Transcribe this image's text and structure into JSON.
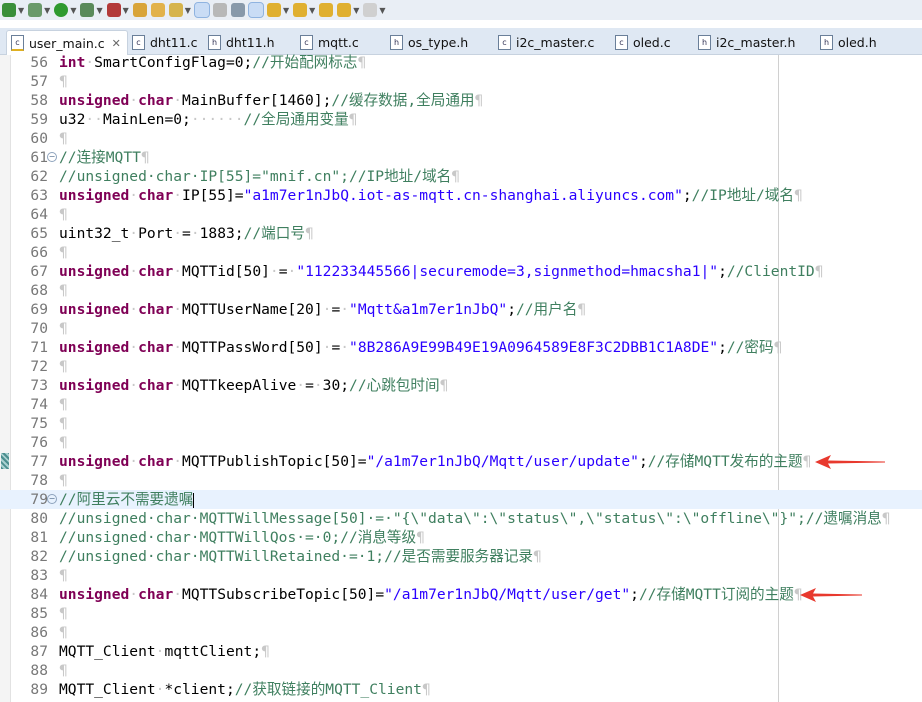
{
  "toolbar": {
    "buttons": [
      {
        "icon": "new-c-project-icon",
        "color": "#3a8f3a",
        "dropdown": true
      },
      {
        "icon": "build-gear-icon",
        "color": "#6a9a6a",
        "dropdown": true
      },
      {
        "icon": "run-icon",
        "color": "#2f9a2f",
        "dropdown": true
      },
      {
        "icon": "debug-icon",
        "color": "#5a8a5a",
        "dropdown": true
      },
      {
        "icon": "external-tools-icon",
        "color": "#b33a3a",
        "dropdown": true
      },
      {
        "icon": "open-type-icon",
        "color": "#d9a53a",
        "dropdown": false
      },
      {
        "icon": "open-folder-icon",
        "color": "#e2b24a",
        "dropdown": false
      },
      {
        "icon": "search-torch-icon",
        "color": "#d6b44c",
        "dropdown": true
      },
      {
        "icon": "mark-occurrences-icon",
        "color": "#e8c95a",
        "dropdown": false,
        "selected": true
      },
      {
        "icon": "word-wrap-icon",
        "color": "#b8b8b8",
        "dropdown": false
      },
      {
        "icon": "block-selection-icon",
        "color": "#8899aa",
        "dropdown": false
      },
      {
        "icon": "show-whitespace-icon",
        "color": "#7f94b0",
        "dropdown": false,
        "selected": true
      },
      {
        "icon": "next-annotation-icon",
        "color": "#e0b030",
        "dropdown": true
      },
      {
        "icon": "previous-annotation-icon",
        "color": "#e0b030",
        "dropdown": true
      },
      {
        "icon": "last-edit-location-icon",
        "color": "#e0b030",
        "dropdown": false
      },
      {
        "icon": "back-icon",
        "color": "#e0b030",
        "dropdown": true
      },
      {
        "icon": "forward-icon",
        "color": "#d0d0d0",
        "dropdown": true
      }
    ]
  },
  "tabs": [
    {
      "label": "user_main.c",
      "type": "c",
      "active": true,
      "warning": true
    },
    {
      "label": "dht11.c",
      "type": "c"
    },
    {
      "label": "dht11.h",
      "type": "h"
    },
    {
      "label": "mqtt.c",
      "type": "c"
    },
    {
      "label": "os_type.h",
      "type": "h"
    },
    {
      "label": "i2c_master.c",
      "type": "c"
    },
    {
      "label": "oled.c",
      "type": "c"
    },
    {
      "label": "i2c_master.h",
      "type": "h"
    },
    {
      "label": "oled.h",
      "type": "h"
    }
  ],
  "tab_close_glyph": "✕",
  "colors": {
    "keyword": "#7f0055",
    "comment": "#3f7f5f",
    "string": "#2a00ff",
    "annotation_arrow": "#e8392e",
    "current_line": "#e8f2fe"
  },
  "editor": {
    "current_line": 79,
    "bookmark_line": 77,
    "arrow_lines": [
      77,
      84
    ],
    "lines": [
      {
        "n": "56",
        "t": [
          [
            "k",
            "int"
          ],
          [
            "w",
            "·"
          ],
          [
            "p",
            "SmartConfigFlag=0;"
          ],
          [
            "c",
            "//开始配网标志"
          ],
          [
            "w",
            "¶"
          ]
        ]
      },
      {
        "n": "57",
        "t": [
          [
            "w",
            "¶"
          ]
        ]
      },
      {
        "n": "58",
        "t": [
          [
            "k",
            "unsigned"
          ],
          [
            "w",
            "·"
          ],
          [
            "k",
            "char"
          ],
          [
            "w",
            "·"
          ],
          [
            "p",
            "MainBuffer[1460];"
          ],
          [
            "c",
            "//缓存数据,全局通用"
          ],
          [
            "w",
            "¶"
          ]
        ]
      },
      {
        "n": "59",
        "t": [
          [
            "p",
            "u32"
          ],
          [
            "w",
            "··"
          ],
          [
            "p",
            "MainLen=0;"
          ],
          [
            "w",
            "······"
          ],
          [
            "c",
            "//全局通用变量"
          ],
          [
            "w",
            "¶"
          ]
        ]
      },
      {
        "n": "60",
        "t": [
          [
            "w",
            "¶"
          ]
        ]
      },
      {
        "n": "61",
        "fold": true,
        "t": [
          [
            "c",
            "//连接MQTT"
          ],
          [
            "w",
            "¶"
          ]
        ]
      },
      {
        "n": "62",
        "t": [
          [
            "c",
            "//unsigned·char·IP[55]=\"mnif.cn\";//IP地址/域名"
          ],
          [
            "w",
            "¶"
          ]
        ]
      },
      {
        "n": "63",
        "t": [
          [
            "k",
            "unsigned"
          ],
          [
            "w",
            "·"
          ],
          [
            "k",
            "char"
          ],
          [
            "w",
            "·"
          ],
          [
            "p",
            "IP[55]="
          ],
          [
            "s",
            "\"a1m7er1nJbQ.iot-as-mqtt.cn-shanghai.aliyuncs.com\""
          ],
          [
            "p",
            ";"
          ],
          [
            "c",
            "//IP地址/域名"
          ],
          [
            "w",
            "¶"
          ]
        ]
      },
      {
        "n": "64",
        "t": [
          [
            "w",
            "¶"
          ]
        ]
      },
      {
        "n": "65",
        "t": [
          [
            "p",
            "uint32_t"
          ],
          [
            "w",
            "·"
          ],
          [
            "p",
            "Port"
          ],
          [
            "w",
            "·"
          ],
          [
            "p",
            "="
          ],
          [
            "w",
            "·"
          ],
          [
            "p",
            "1883;"
          ],
          [
            "c",
            "//端口号"
          ],
          [
            "w",
            "¶"
          ]
        ]
      },
      {
        "n": "66",
        "t": [
          [
            "w",
            "¶"
          ]
        ]
      },
      {
        "n": "67",
        "t": [
          [
            "k",
            "unsigned"
          ],
          [
            "w",
            "·"
          ],
          [
            "k",
            "char"
          ],
          [
            "w",
            "·"
          ],
          [
            "p",
            "MQTTid[50]"
          ],
          [
            "w",
            "·"
          ],
          [
            "p",
            "="
          ],
          [
            "w",
            "·"
          ],
          [
            "s",
            "\"112233445566|securemode=3,signmethod=hmacsha1|\""
          ],
          [
            "p",
            ";"
          ],
          [
            "c",
            "//ClientID"
          ],
          [
            "w",
            "¶"
          ]
        ]
      },
      {
        "n": "68",
        "t": [
          [
            "w",
            "¶"
          ]
        ]
      },
      {
        "n": "69",
        "t": [
          [
            "k",
            "unsigned"
          ],
          [
            "w",
            "·"
          ],
          [
            "k",
            "char"
          ],
          [
            "w",
            "·"
          ],
          [
            "p",
            "MQTTUserName[20]"
          ],
          [
            "w",
            "·"
          ],
          [
            "p",
            "="
          ],
          [
            "w",
            "·"
          ],
          [
            "s",
            "\"Mqtt&a1m7er1nJbQ\""
          ],
          [
            "p",
            ";"
          ],
          [
            "c",
            "//用户名"
          ],
          [
            "w",
            "¶"
          ]
        ]
      },
      {
        "n": "70",
        "t": [
          [
            "w",
            "¶"
          ]
        ]
      },
      {
        "n": "71",
        "t": [
          [
            "k",
            "unsigned"
          ],
          [
            "w",
            "·"
          ],
          [
            "k",
            "char"
          ],
          [
            "w",
            "·"
          ],
          [
            "p",
            "MQTTPassWord[50]"
          ],
          [
            "w",
            "·"
          ],
          [
            "p",
            "="
          ],
          [
            "w",
            "·"
          ],
          [
            "s",
            "\"8B286A9E99B49E19A0964589E8F3C2DBB1C1A8DE\""
          ],
          [
            "p",
            ";"
          ],
          [
            "c",
            "//密码"
          ],
          [
            "w",
            "¶"
          ]
        ]
      },
      {
        "n": "72",
        "t": [
          [
            "w",
            "¶"
          ]
        ]
      },
      {
        "n": "73",
        "t": [
          [
            "k",
            "unsigned"
          ],
          [
            "w",
            "·"
          ],
          [
            "k",
            "char"
          ],
          [
            "w",
            "·"
          ],
          [
            "p",
            "MQTTkeepAlive"
          ],
          [
            "w",
            "·"
          ],
          [
            "p",
            "="
          ],
          [
            "w",
            "·"
          ],
          [
            "p",
            "30;"
          ],
          [
            "c",
            "//心跳包时间"
          ],
          [
            "w",
            "¶"
          ]
        ]
      },
      {
        "n": "74",
        "t": [
          [
            "w",
            "¶"
          ]
        ]
      },
      {
        "n": "75",
        "t": [
          [
            "w",
            "¶"
          ]
        ]
      },
      {
        "n": "76",
        "t": [
          [
            "w",
            "¶"
          ]
        ]
      },
      {
        "n": "77",
        "t": [
          [
            "k",
            "unsigned"
          ],
          [
            "w",
            "·"
          ],
          [
            "k",
            "char"
          ],
          [
            "w",
            "·"
          ],
          [
            "p",
            "MQTTPublishTopic[50]="
          ],
          [
            "s",
            "\"/a1m7er1nJbQ/Mqtt/user/update\""
          ],
          [
            "p",
            ";"
          ],
          [
            "c",
            "//存储MQTT发布的主题"
          ],
          [
            "w",
            "¶"
          ]
        ]
      },
      {
        "n": "78",
        "t": [
          [
            "w",
            "¶"
          ]
        ]
      },
      {
        "n": "79",
        "fold": true,
        "t": [
          [
            "c",
            "//阿里云不需要遗嘱"
          ]
        ]
      },
      {
        "n": "80",
        "t": [
          [
            "c",
            "//unsigned·char·MQTTWillMessage[50]·=·\"{\\\"data\\\":\\\"status\\\",\\\"status\\\":\\\"offline\\\"}\";//遗嘱消息"
          ],
          [
            "w",
            "¶"
          ]
        ]
      },
      {
        "n": "81",
        "t": [
          [
            "c",
            "//unsigned·char·MQTTWillQos·=·0;//消息等级"
          ],
          [
            "w",
            "¶"
          ]
        ]
      },
      {
        "n": "82",
        "t": [
          [
            "c",
            "//unsigned·char·MQTTWillRetained·=·1;//是否需要服务器记录"
          ],
          [
            "w",
            "¶"
          ]
        ]
      },
      {
        "n": "83",
        "t": [
          [
            "w",
            "¶"
          ]
        ]
      },
      {
        "n": "84",
        "t": [
          [
            "k",
            "unsigned"
          ],
          [
            "w",
            "·"
          ],
          [
            "k",
            "char"
          ],
          [
            "w",
            "·"
          ],
          [
            "p",
            "MQTTSubscribeTopic[50]="
          ],
          [
            "s",
            "\"/a1m7er1nJbQ/Mqtt/user/get\""
          ],
          [
            "p",
            ";"
          ],
          [
            "c",
            "//存储MQTT订阅的主题"
          ],
          [
            "w",
            "¶"
          ]
        ]
      },
      {
        "n": "85",
        "t": [
          [
            "w",
            "¶"
          ]
        ]
      },
      {
        "n": "86",
        "t": [
          [
            "w",
            "¶"
          ]
        ]
      },
      {
        "n": "87",
        "t": [
          [
            "p",
            "MQTT_Client"
          ],
          [
            "w",
            "·"
          ],
          [
            "p",
            "mqttClient;"
          ],
          [
            "w",
            "¶"
          ]
        ]
      },
      {
        "n": "88",
        "t": [
          [
            "w",
            "¶"
          ]
        ]
      },
      {
        "n": "89",
        "t": [
          [
            "p",
            "MQTT_Client"
          ],
          [
            "w",
            "·"
          ],
          [
            "p",
            "*client;"
          ],
          [
            "c",
            "//获取链接的MQTT_Client"
          ],
          [
            "w",
            "¶"
          ]
        ]
      }
    ]
  }
}
